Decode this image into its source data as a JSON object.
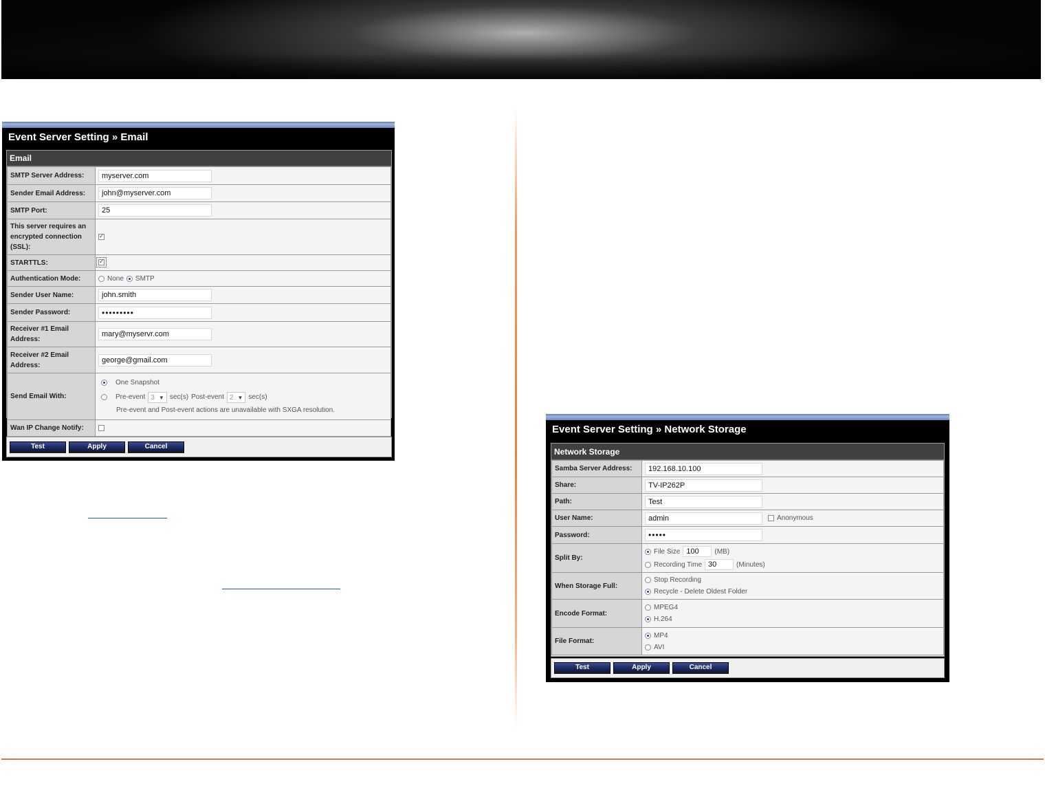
{
  "email_panel": {
    "title": "Event Server Setting » Email",
    "section": "Email",
    "fields": {
      "smtp_server": {
        "label": "SMTP Server Address:",
        "value": "myserver.com"
      },
      "sender_email": {
        "label": "Sender Email Address:",
        "value": "john@myserver.com"
      },
      "smtp_port": {
        "label": "SMTP Port:",
        "value": "25"
      },
      "ssl": {
        "label": "This server requires an encrypted connection (SSL):",
        "checked": true
      },
      "starttls": {
        "label": "STARTTLS:",
        "checked": true
      },
      "auth_mode": {
        "label": "Authentication Mode:",
        "options": [
          "None",
          "SMTP"
        ],
        "selected": "SMTP"
      },
      "sender_user": {
        "label": "Sender User Name:",
        "value": "john.smith"
      },
      "sender_password": {
        "label": "Sender Password:",
        "value": "•••••••••"
      },
      "receiver1": {
        "label": "Receiver #1 Email Address:",
        "value": "mary@myservr.com"
      },
      "receiver2": {
        "label": "Receiver #2 Email Address:",
        "value": "george@gmail.com"
      },
      "send_with": {
        "label": "Send Email With:",
        "one_snapshot": "One Snapshot",
        "pre_event": "Pre-event",
        "pre_value": "3",
        "sec1": "sec(s)",
        "post_event": "Post-event",
        "post_value": "2",
        "sec2": "sec(s)",
        "note": "Pre-event and Post-event actions are unavailable with SXGA resolution.",
        "selected": "One Snapshot"
      },
      "wan_ip": {
        "label": "Wan IP Change Notify:",
        "checked": false
      }
    },
    "buttons": {
      "test": "Test",
      "apply": "Apply",
      "cancel": "Cancel"
    }
  },
  "storage_panel": {
    "title": "Event Server Setting » Network Storage",
    "section": "Network Storage",
    "fields": {
      "samba": {
        "label": "Samba Server Address:",
        "value": "192.168.10.100"
      },
      "share": {
        "label": "Share:",
        "value": "TV-IP262P"
      },
      "path": {
        "label": "Path:",
        "value": "Test"
      },
      "user": {
        "label": "User Name:",
        "value": "admin",
        "anonymous_label": "Anonymous",
        "anonymous": false
      },
      "password": {
        "label": "Password:",
        "value": "•••••"
      },
      "split_by": {
        "label": "Split By:",
        "file_size_label": "File Size",
        "file_size": "100",
        "file_size_unit": "(MB)",
        "rec_time_label": "Recording Time",
        "rec_time": "30",
        "rec_time_unit": "(Minutes)",
        "selected": "File Size"
      },
      "storage_full": {
        "label": "When Storage Full:",
        "options": [
          "Stop Recording",
          "Recycle - Delete Oldest Folder"
        ],
        "selected": "Recycle - Delete Oldest Folder"
      },
      "encode": {
        "label": "Encode Format:",
        "options": [
          "MPEG4",
          "H.264"
        ],
        "selected": "H.264"
      },
      "file_format": {
        "label": "File Format:",
        "options": [
          "MP4",
          "AVI"
        ],
        "selected": "MP4"
      }
    },
    "buttons": {
      "test": "Test",
      "apply": "Apply",
      "cancel": "Cancel"
    }
  },
  "colors": {
    "accent_orange": "#e9803b",
    "panel_black": "#000000",
    "button_navy": "#1c2b66",
    "link_blue": "#2a4fd6"
  }
}
